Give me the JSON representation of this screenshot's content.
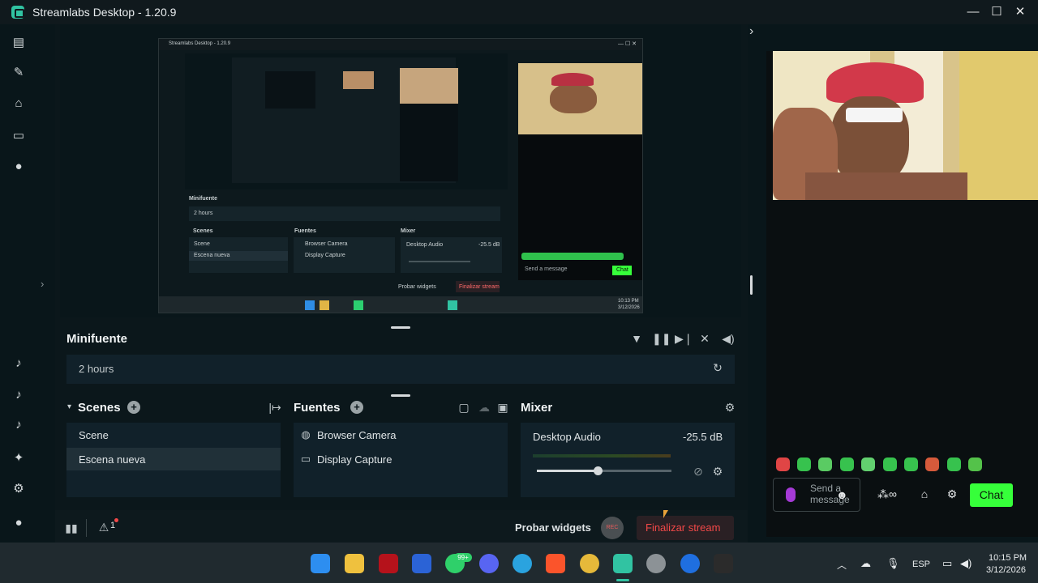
{
  "window": {
    "title": "Streamlabs Desktop - 1.20.9",
    "minimize": "—",
    "maximize": "☐",
    "close": "✕"
  },
  "sidebar": {
    "icons": [
      "editor-icon",
      "themes-icon",
      "store-icon",
      "layout-icon",
      "record-icon",
      "tiktok-icon",
      "tiktok-icon-2",
      "tiktok-icon-3",
      "ai-icon",
      "settings-icon",
      "profile-icon"
    ]
  },
  "preview": {
    "inner": {
      "title": "Streamlabs Desktop - 1.20.9",
      "minifuente": "Minifuente",
      "hours": "2 hours",
      "scenes": "Scenes",
      "fuentes": "Fuentes",
      "mixer": "Mixer",
      "scene": "Scene",
      "scene_new": "Escena nueva",
      "browser_camera": "Browser Camera",
      "display_capture": "Display Capture",
      "desktop_audio": "Desktop Audio",
      "db": "-25.5 dB",
      "probar": "Probar widgets",
      "finalizar": "Finalizar stream",
      "send": "Send a message",
      "chat": "Chat",
      "time": "10:13 PM",
      "date": "3/12/2026"
    }
  },
  "minifuente": {
    "title": "Minifuente",
    "time_field": "2 hours"
  },
  "scenes": {
    "title": "Scenes",
    "items": [
      "Scene",
      "Escena nueva"
    ],
    "selected": 1
  },
  "sources": {
    "title": "Fuentes",
    "items": [
      "Browser Camera",
      "Display Capture"
    ]
  },
  "mixer": {
    "title": "Mixer",
    "channel": "Desktop Audio",
    "level": "-25.5 dB",
    "volume_fraction": 0.45
  },
  "footer": {
    "warning_count": "1",
    "test_widgets": "Probar widgets",
    "rec": "REC",
    "end_stream": "Finalizar stream"
  },
  "chat": {
    "placeholder": "Send a message",
    "chat_button": "Chat"
  },
  "taskbar": {
    "language": "ESP",
    "time": "10:15 PM",
    "date": "3/12/2026",
    "whatsapp_badge": "99+"
  },
  "colors": {
    "accent": "#31c3a2",
    "end_stream_red": "#f24848",
    "chat_button_green": "#36ff3a"
  }
}
